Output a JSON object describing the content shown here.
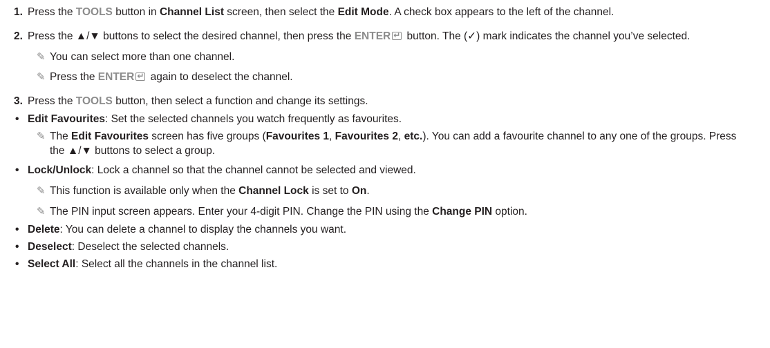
{
  "steps": {
    "s1": {
      "num": "1.",
      "t1": "Press the ",
      "tools": "TOOLS",
      "t2": " button in ",
      "channel_list": "Channel List",
      "t3": " screen, then select the ",
      "edit_mode": "Edit Mode",
      "t4": ". A check box appears to the left of the channel."
    },
    "s2": {
      "num": "2.",
      "t1": "Press the ▲/▼ buttons to select the desired channel, then press the ",
      "enter": "ENTER",
      "t2": " button. The (✓) mark indicates the channel you’ve selected."
    },
    "s3": {
      "num": "3.",
      "t1": "Press the ",
      "tools": "TOOLS",
      "t2": " button, then select a function and change its settings."
    }
  },
  "notes": {
    "n1": "You can select more than one channel.",
    "n2a": "Press the ",
    "n2_enter": "ENTER",
    "n2b": " again to deselect the channel.",
    "n3a": "The ",
    "n3_ef": "Edit Favourites",
    "n3b": " screen has five groups (",
    "n3_f1": "Favourites 1",
    "n3c": ", ",
    "n3_f2": "Favourites 2",
    "n3d": ", ",
    "n3_etc": "etc.",
    "n3e": "). You can add a favourite channel to any one of the groups. Press the ▲/▼ buttons to select a group.",
    "n4a": "This function is available only when the ",
    "n4_cl": "Channel Lock",
    "n4b": " is set to ",
    "n4_on": "On",
    "n4c": ".",
    "n5a": "The PIN input screen appears. Enter your 4-digit PIN. Change the PIN using the ",
    "n5_cp": "Change PIN",
    "n5b": " option."
  },
  "bullets": {
    "dot": "•",
    "b1_term": "Edit Favourites",
    "b1_text": ": Set the selected channels you watch frequently as favourites.",
    "b2_term": "Lock/Unlock",
    "b2_text": ": Lock a channel so that the channel cannot be selected and viewed.",
    "b3_term": "Delete",
    "b3_text": ": You can delete a channel to display the channels you want.",
    "b4_term": "Deselect",
    "b4_text": ": Deselect the selected channels.",
    "b5_term": "Select All",
    "b5_text": ": Select all the channels in the channel list."
  },
  "icons": {
    "note": "pencil-note-icon",
    "enter": "enter-icon"
  },
  "colors": {
    "text": "#231f20",
    "highlight": "#8c8c8c"
  }
}
